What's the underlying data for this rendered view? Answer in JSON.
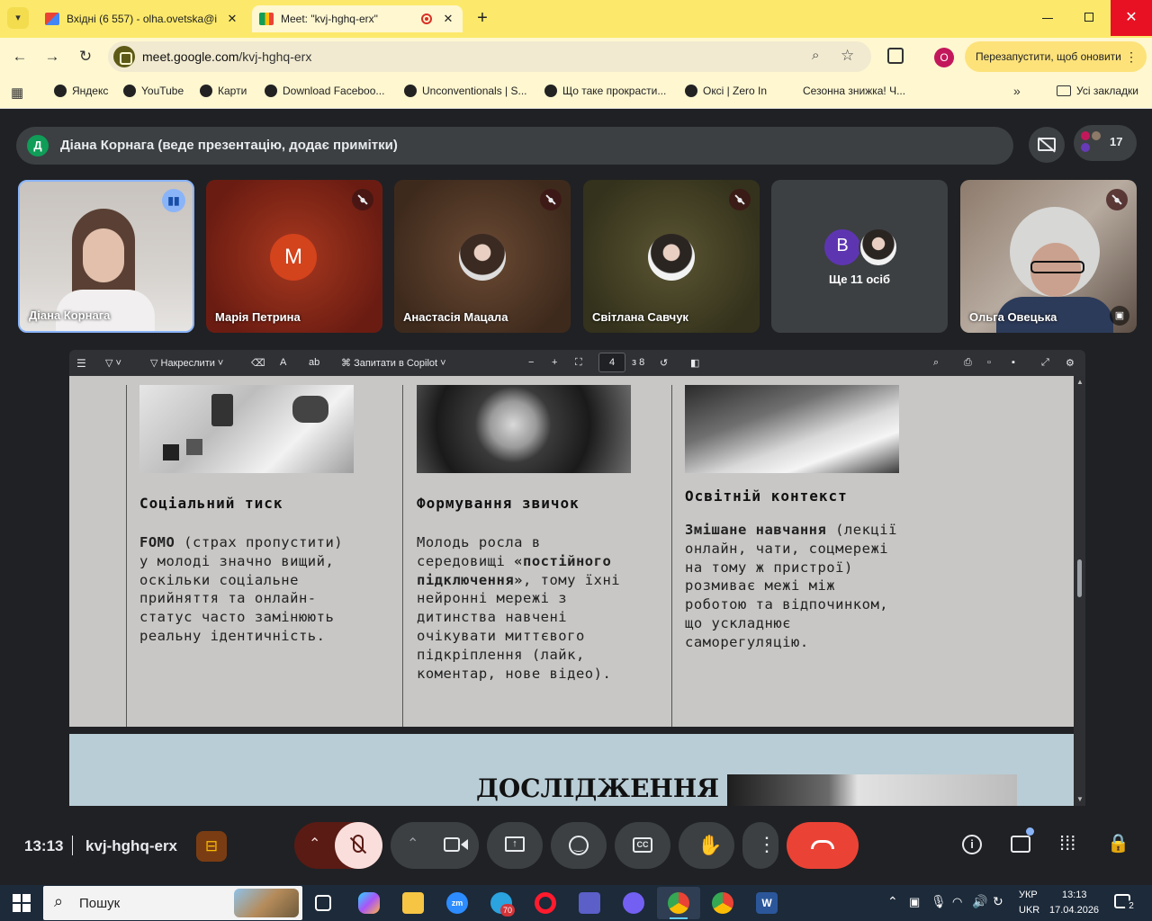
{
  "browser": {
    "tabs": [
      {
        "title": "Вхідні (6 557) - olha.ovetska@i",
        "close": "✕"
      },
      {
        "title": "Meet: \"kvj-hghq-erx\"",
        "close": "✕"
      }
    ],
    "new_tab": "+",
    "url_host": "meet.google.com",
    "url_path": "/kvj-hghq-erx",
    "profile_letter": "O",
    "update_button": "Перезапустити, щоб оновити",
    "bookmarks": [
      "Яндекс",
      "YouTube",
      "Карти",
      "Download Faceboo...",
      "Unconventionals | S...",
      "Що таке прокрасти...",
      "Oкcі | Zero In",
      "Сезонна знижка! Ч..."
    ],
    "all_bookmarks": "Усі закладки"
  },
  "meet": {
    "presenter": {
      "initial": "Д",
      "text": "Діана Корнага (веде презентацію, додає примітки)"
    },
    "participant_count": "17",
    "tiles": [
      {
        "name": "Діана Корнага"
      },
      {
        "name": "Марія Петрина",
        "initial": "M"
      },
      {
        "name": "Анастасія Мацала"
      },
      {
        "name": "Світлана Савчук"
      },
      {
        "name": "Ще 11 осіб",
        "initial": "B"
      },
      {
        "name": "Ольга Овецька"
      }
    ],
    "time": "13:13",
    "meeting_code": "kvj-hghq-erx"
  },
  "pdf_toolbar": {
    "draw": "Накреслити",
    "copilot": "Запитати в Copilot",
    "page": "4",
    "of": "з 8"
  },
  "slide": {
    "columns": [
      {
        "title": "Соціальний тиск",
        "lead": "FOMO",
        "body": " (страх пропустити) у молоді значно вищий, оскільки соціальне прийняття та онлайн-статус часто замінюють реальну ідентичність."
      },
      {
        "title": "Формування звичок",
        "pre": "Молодь росла в середовищі ",
        "bold": "«постійного підключення»",
        "post": ", тому їхні нейронні мережі з дитинства навчені очікувати миттєвого підкріплення (лайк, коментар, нове відео)."
      },
      {
        "title": "Освітній контекст",
        "lead": "Змішане навчання",
        "body": " (лекції онлайн, чати, соцмережі на тому ж пристрої) розмиває межі між роботою та відпочинком, що ускладнює саморегуляцію."
      }
    ],
    "next_heading": "ДОСЛІДЖЕННЯ"
  },
  "taskbar": {
    "search": "Пошук",
    "lang_top": "УКР",
    "lang_bottom": "UKR",
    "time": "13:13",
    "date": "17.04.2026",
    "notifications": "2",
    "telegram_badge": "70"
  },
  "colors": {
    "tabbar": "#fce96b",
    "hangup": "#ea4335",
    "mic_off": "#f9dedc"
  }
}
